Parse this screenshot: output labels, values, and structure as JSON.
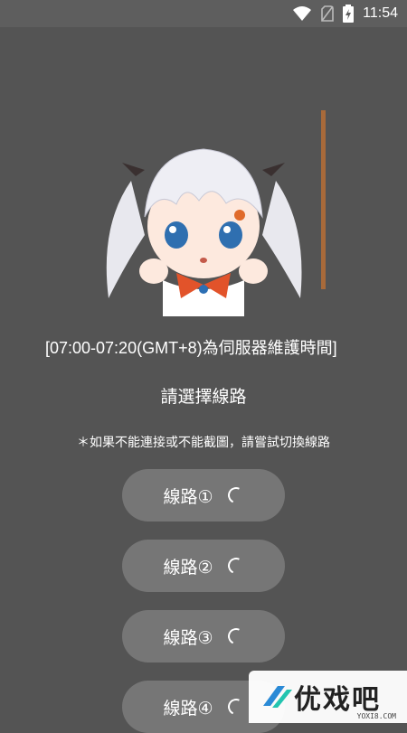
{
  "status_bar": {
    "time": "11:54"
  },
  "notice": "[07:00-07:20(GMT+8)為伺服器維護時間]",
  "title": "請選擇線路",
  "hint": "＊如果不能連接或不能截圖，請嘗試切換線路",
  "routes": [
    {
      "label": "線路①"
    },
    {
      "label": "線路②"
    },
    {
      "label": "線路③"
    },
    {
      "label": "線路④"
    }
  ],
  "watermark": {
    "text": "优戏吧",
    "sub": "YOXI8.COM"
  },
  "colors": {
    "background": "#545454",
    "button": "#767676",
    "accent": "#a86a3a"
  }
}
